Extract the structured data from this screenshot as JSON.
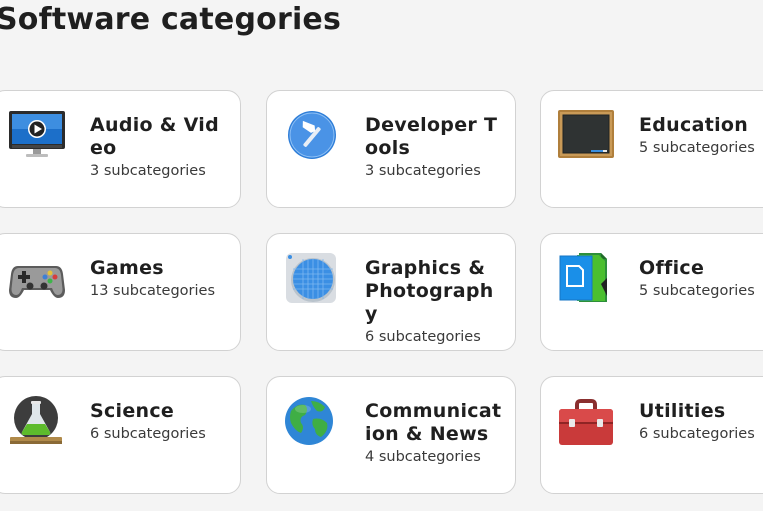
{
  "page": {
    "title": "Software categories"
  },
  "categories": [
    {
      "name": "Audio & Video",
      "subcategories": "3 subcategories",
      "icon": "audio-video-icon"
    },
    {
      "name": "Developer Tools",
      "subcategories": "3 subcategories",
      "icon": "developer-tools-icon"
    },
    {
      "name": "Education",
      "subcategories": "5 subcategories",
      "icon": "education-icon"
    },
    {
      "name": "Games",
      "subcategories": "13 subcategories",
      "icon": "games-icon"
    },
    {
      "name": "Graphics & Photography",
      "subcategories": "6 subcategories",
      "icon": "graphics-icon"
    },
    {
      "name": "Office",
      "subcategories": "5 subcategories",
      "icon": "office-icon"
    },
    {
      "name": "Science",
      "subcategories": "6 subcategories",
      "icon": "science-icon"
    },
    {
      "name": "Communication & News",
      "subcategories": "4 subcategories",
      "icon": "communication-icon"
    },
    {
      "name": "Utilities",
      "subcategories": "6 subcategories",
      "icon": "utilities-icon"
    }
  ]
}
